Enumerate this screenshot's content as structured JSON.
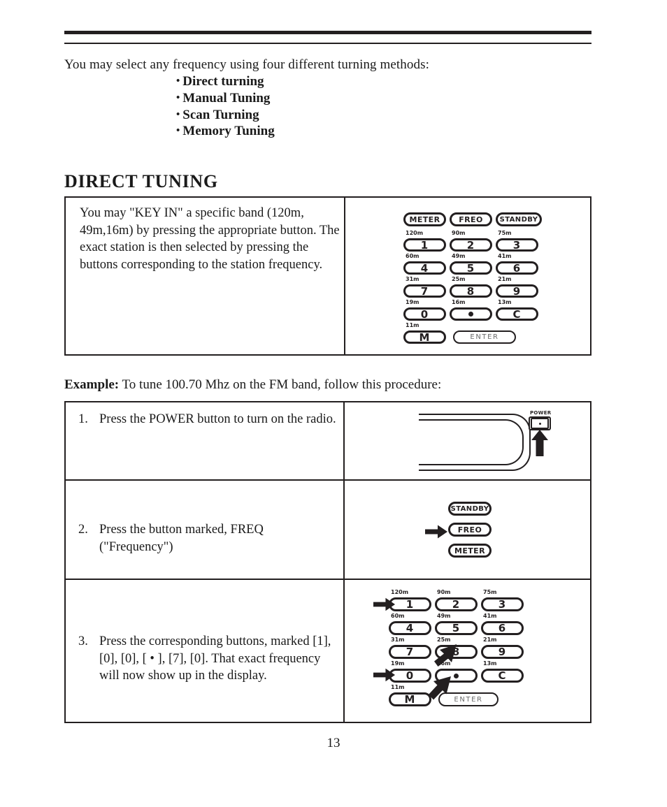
{
  "document": {
    "page_number": "13",
    "intro_text": "You may select any frequency using four different turning methods:",
    "tuning_methods": [
      "Direct turning",
      "Manual Tuning",
      "Scan Turning",
      "Memory Tuning"
    ],
    "section_heading": "DIRECT TUNING",
    "bullet_glyph": "•"
  },
  "direct_tuning_box": {
    "description": "You may \"KEY IN\" a specific band (120m, 49m,16m) by pressing the appropriate button. The exact station is then selected by pressing the buttons corresponding to the station frequency.",
    "keypad": {
      "top_row": [
        "METER",
        "FREO",
        "STANDBY"
      ],
      "rows": [
        [
          {
            "band": "120m",
            "key": "1"
          },
          {
            "band": "90m",
            "key": "2"
          },
          {
            "band": "75m",
            "key": "3"
          }
        ],
        [
          {
            "band": "60m",
            "key": "4"
          },
          {
            "band": "49m",
            "key": "5"
          },
          {
            "band": "41m",
            "key": "6"
          }
        ],
        [
          {
            "band": "31m",
            "key": "7"
          },
          {
            "band": "25m",
            "key": "8"
          },
          {
            "band": "21m",
            "key": "9"
          }
        ],
        [
          {
            "band": "19m",
            "key": "0"
          },
          {
            "band": "16m",
            "key": "•"
          },
          {
            "band": "13m",
            "key": "C"
          }
        ],
        [
          {
            "band": "11m",
            "key": "M"
          },
          {
            "band": "",
            "key": "ENTER"
          }
        ]
      ]
    }
  },
  "example": {
    "label": "Example:",
    "text": "To tune 100.70 Mhz on the FM band, follow this procedure:"
  },
  "steps": [
    {
      "number": "1.",
      "text": "Press the POWER button to turn on the radio.",
      "illustration": {
        "power_label": "POWER",
        "arrow_target": "power-button"
      }
    },
    {
      "number": "2.",
      "text": "Press the button marked, FREQ (\"Frequency\")",
      "illustration": {
        "buttons": [
          "STANDBY",
          "FREO",
          "METER"
        ],
        "arrow_target": "FREO"
      }
    },
    {
      "number": "3.",
      "text": "Press the corresponding buttons, marked [1], [0], [0], [ • ], [7], [0]. That exact frequency will now show up in the display.",
      "illustration": {
        "arrow_targets": [
          "1",
          "7",
          "0",
          "•"
        ],
        "keypad": {
          "rows": [
            [
              {
                "band": "120m",
                "key": "1"
              },
              {
                "band": "90m",
                "key": "2"
              },
              {
                "band": "75m",
                "key": "3"
              }
            ],
            [
              {
                "band": "60m",
                "key": "4"
              },
              {
                "band": "49m",
                "key": "5"
              },
              {
                "band": "41m",
                "key": "6"
              }
            ],
            [
              {
                "band": "31m",
                "key": "7"
              },
              {
                "band": "25m",
                "key": "8"
              },
              {
                "band": "21m",
                "key": "9"
              }
            ],
            [
              {
                "band": "19m",
                "key": "0"
              },
              {
                "band": "16m",
                "key": "•"
              },
              {
                "band": "13m",
                "key": "C"
              }
            ],
            [
              {
                "band": "11m",
                "key": "M"
              },
              {
                "band": "",
                "key": "ENTER"
              }
            ]
          ]
        }
      }
    }
  ],
  "colors": {
    "ink": "#231f20",
    "enter_text": "#6b6b6b",
    "page_bg": "#ffffff"
  }
}
